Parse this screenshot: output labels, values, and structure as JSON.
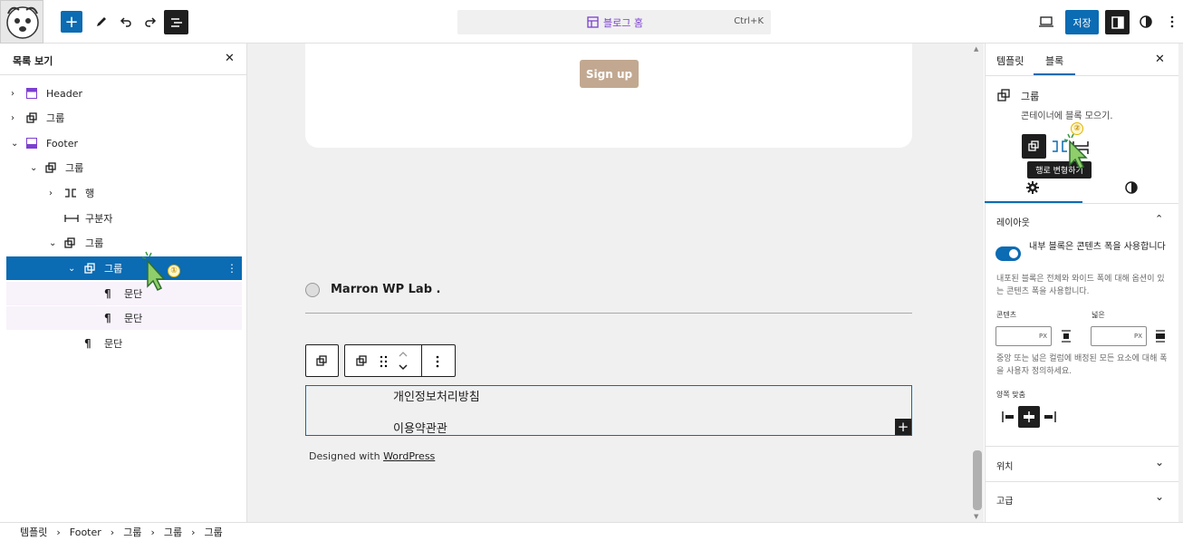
{
  "topbar": {
    "command_title": "블로그 홈",
    "command_shortcut": "Ctrl+K",
    "save_label": "저장"
  },
  "listview": {
    "title": "목록 보기",
    "items": [
      {
        "label": "Header"
      },
      {
        "label": "그룹"
      },
      {
        "label": "Footer"
      },
      {
        "label": "그룹"
      },
      {
        "label": "행"
      },
      {
        "label": "구분자"
      },
      {
        "label": "그룹"
      },
      {
        "label": "그룹"
      },
      {
        "label": "문단"
      },
      {
        "label": "문단"
      },
      {
        "label": "문단"
      }
    ]
  },
  "canvas": {
    "signup_label": "Sign up",
    "site_name": "Marron WP Lab .",
    "paragraph_1": "개인정보처리방침",
    "paragraph_2": "이용약관관",
    "designed_prefix": "Designed with ",
    "designed_link": "WordPress"
  },
  "inspector": {
    "tab_template": "템플릿",
    "tab_block": "블록",
    "block_name": "그룹",
    "block_description": "콘테이너에 블록 모으기.",
    "tooltip": "행로 변형하기",
    "layout_title": "레이아웃",
    "toggle_label": "내부 블록은 콘텐츠 폭을 사용합니다",
    "toggle_help": "내포된 블록은 전체와 와이드 폭에 대해 옵션이 있는 콘텐츠 폭을 사용합니다.",
    "content_label": "콘텐츠",
    "wide_label": "넓은",
    "unit": "PX",
    "width_help": "중앙 또는 넓은 컬럼에 배정된 모든 요소에 대해 폭을 사용자 정의하세요.",
    "justify_title": "양쪽 맞춤",
    "position_title": "위치",
    "advanced_title": "고급"
  },
  "breadcrumb": [
    "템플릿",
    "Footer",
    "그룹",
    "그룹",
    "그룹"
  ],
  "badges": {
    "one": "①",
    "two": "②"
  },
  "colors": {
    "accent": "#0b6bb3",
    "purple": "#7b3fd0",
    "signup": "#c2a890"
  }
}
